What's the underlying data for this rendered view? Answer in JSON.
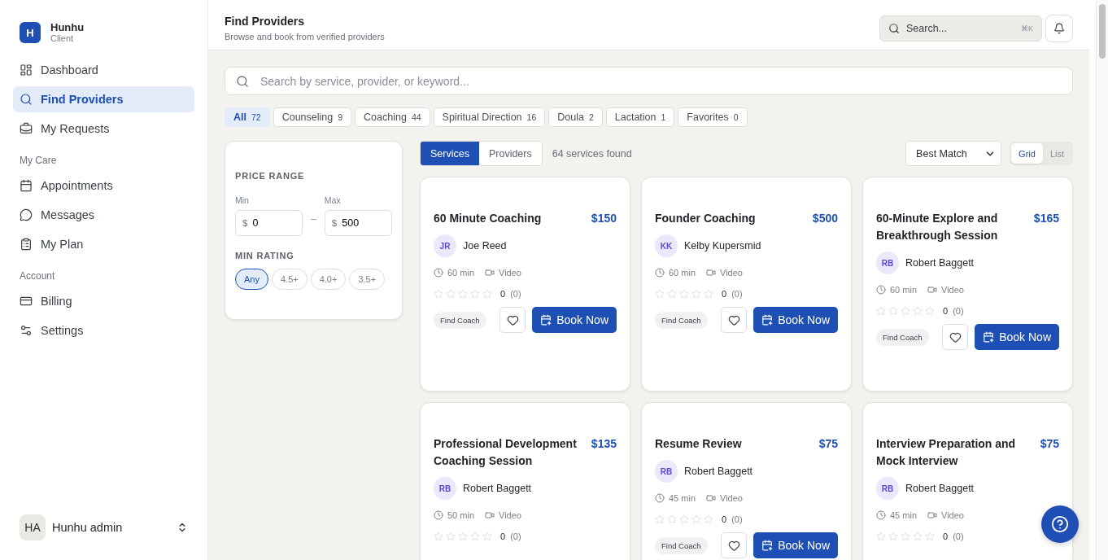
{
  "brand": {
    "initial": "H",
    "name": "Hunhu",
    "role": "Client"
  },
  "sidebar": {
    "sections": [
      {
        "items": [
          {
            "label": "Dashboard",
            "selected": false
          },
          {
            "label": "Find Providers",
            "selected": true
          },
          {
            "label": "My Requests",
            "selected": false
          }
        ]
      },
      {
        "heading": "My Care",
        "items": [
          {
            "label": "Appointments",
            "selected": false
          },
          {
            "label": "Messages",
            "selected": false
          },
          {
            "label": "My Plan",
            "selected": false
          }
        ]
      },
      {
        "heading": "Account",
        "items": [
          {
            "label": "Billing",
            "selected": false
          },
          {
            "label": "Settings",
            "selected": false
          }
        ]
      }
    ]
  },
  "user": {
    "initials": "HA",
    "name": "Hunhu admin"
  },
  "header": {
    "title": "Find Providers",
    "subtitle": "Browse and book from verified providers",
    "search": {
      "placeholder": "Search...",
      "shortcut": "⌘K"
    }
  },
  "search": {
    "placeholder": "Search by service, provider, or keyword..."
  },
  "categories": [
    {
      "label": "All",
      "count": "72",
      "selected": true
    },
    {
      "label": "Counseling",
      "count": "9",
      "selected": false
    },
    {
      "label": "Coaching",
      "count": "44",
      "selected": false
    },
    {
      "label": "Spiritual Direction",
      "count": "16",
      "selected": false
    },
    {
      "label": "Doula",
      "count": "2",
      "selected": false
    },
    {
      "label": "Lactation",
      "count": "1",
      "selected": false
    },
    {
      "label": "Favorites",
      "count": "0",
      "selected": false
    }
  ],
  "filters": {
    "price_heading": "PRICE RANGE",
    "min": {
      "label": "Min",
      "currency": "$",
      "value": "0"
    },
    "range_separator": "–",
    "max": {
      "label": "Max",
      "currency": "$",
      "value": "500"
    },
    "rating_heading": "MIN RATING",
    "ratings": [
      {
        "label": "Any",
        "selected": true
      },
      {
        "label": "4.5+",
        "selected": false
      },
      {
        "label": "4.0+",
        "selected": false
      },
      {
        "label": "3.5+",
        "selected": false
      }
    ]
  },
  "view_tabs": [
    {
      "label": "Services",
      "selected": true
    },
    {
      "label": "Providers",
      "selected": false
    }
  ],
  "result_count": "64 services found",
  "sort": {
    "value": "Best Match"
  },
  "layout_toggle": [
    {
      "label": "Grid",
      "selected": true
    },
    {
      "label": "List",
      "selected": false
    }
  ],
  "cards": [
    {
      "title": "60 Minute Coaching",
      "price": "$150",
      "provider_initials": "JR",
      "provider": "Joe Reed",
      "duration": "60 min",
      "mode": "Video",
      "stars": 0,
      "rating": "0",
      "reviews": "(0)",
      "tag": "Find Coach",
      "book_label": "Book Now"
    },
    {
      "title": "Founder Coaching",
      "price": "$500",
      "provider_initials": "KK",
      "provider": "Kelby Kupersmid",
      "duration": "60 min",
      "mode": "Video",
      "stars": 0,
      "rating": "0",
      "reviews": "(0)",
      "tag": "Find Coach",
      "book_label": "Book Now"
    },
    {
      "title": "60-Minute Explore and Breakthrough Session",
      "price": "$165",
      "provider_initials": "RB",
      "provider": "Robert Baggett",
      "duration": "60 min",
      "mode": "Video",
      "stars": 0,
      "rating": "0",
      "reviews": "(0)",
      "tag": "Find Coach",
      "book_label": "Book Now"
    },
    {
      "title": "Professional Development Coaching Session",
      "price": "$135",
      "provider_initials": "RB",
      "provider": "Robert Baggett",
      "duration": "50 min",
      "mode": "Video",
      "stars": 0,
      "rating": "0",
      "reviews": "(0)"
    },
    {
      "title": "Resume Review",
      "price": "$75",
      "provider_initials": "RB",
      "provider": "Robert Baggett",
      "duration": "45 min",
      "mode": "Video",
      "stars": 0,
      "rating": "0",
      "reviews": "(0)",
      "tag": "Find Coach",
      "book_label": "Book Now"
    },
    {
      "title": "Interview Preparation and Mock Interview",
      "price": "$75",
      "provider_initials": "RB",
      "provider": "Robert Baggett",
      "duration": "45 min",
      "mode": "Video",
      "stars": 0,
      "rating": "0",
      "reviews": "(0)"
    }
  ]
}
